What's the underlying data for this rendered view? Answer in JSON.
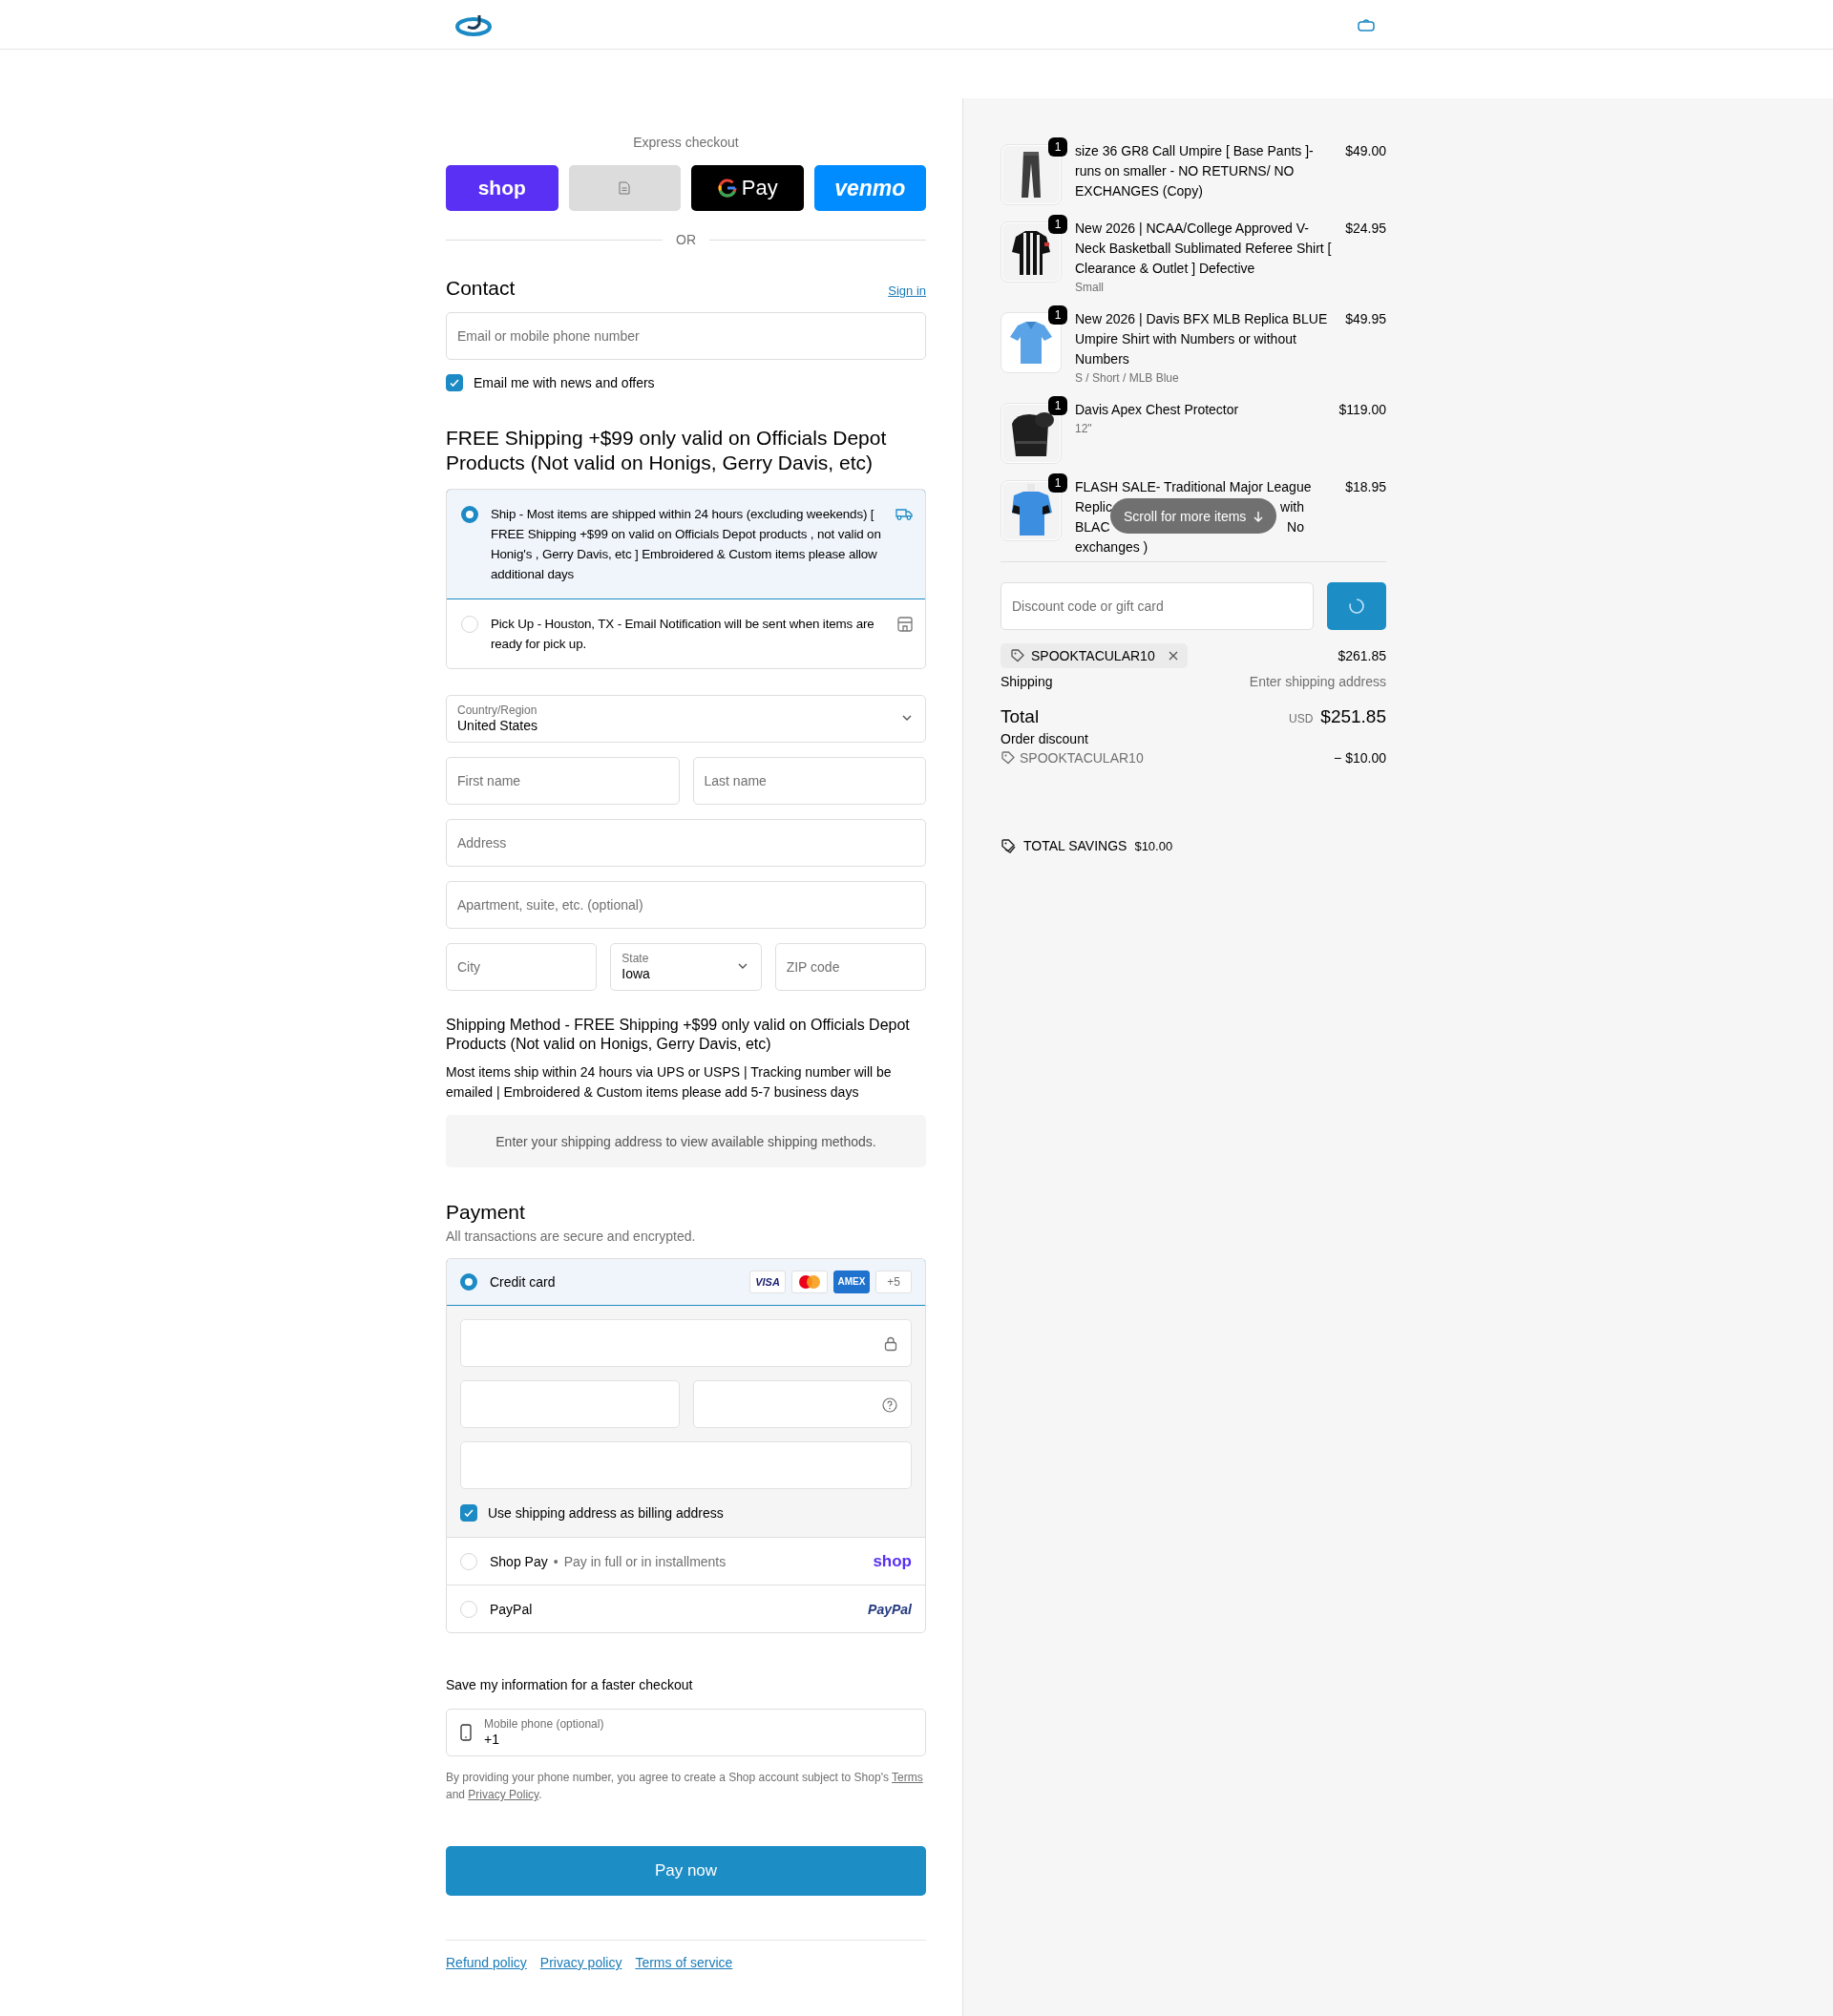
{
  "express_checkout": {
    "label": "Express checkout",
    "buttons": [
      {
        "kind": "shop",
        "label": "shop"
      },
      {
        "kind": "blank"
      },
      {
        "kind": "gpay",
        "label": "Pay"
      },
      {
        "kind": "venmo",
        "label": "venmo"
      }
    ],
    "divider": "OR"
  },
  "contact": {
    "title": "Contact",
    "sign_in": "Sign in",
    "email": {
      "placeholder": "Email or mobile phone number"
    },
    "newsletter": {
      "label": "Email me with news and offers",
      "checked": true
    }
  },
  "delivery": {
    "title": "FREE Shipping +$99 only valid on Officials Depot Products (Not valid on Honigs, Gerry Davis, etc)",
    "options": [
      {
        "kind": "ship",
        "label": "Ship - Most items are shipped within 24 hours (excluding weekends) [ FREE Shipping +$99 on valid on Officials Depot products , not valid on Honig's , Gerry Davis, etc ] Embroidered & Custom items please allow additional days",
        "selected": true
      },
      {
        "kind": "pickup",
        "label": "Pick Up - Houston, TX - Email Notification will be sent when items are ready for pick up.",
        "selected": false
      }
    ]
  },
  "address": {
    "country": {
      "label": "Country/Region",
      "value": "United States"
    },
    "first_name": {
      "placeholder": "First name"
    },
    "last_name": {
      "placeholder": "Last name"
    },
    "address": {
      "placeholder": "Address"
    },
    "apartment": {
      "placeholder": "Apartment, suite, etc. (optional)"
    },
    "city": {
      "placeholder": "City"
    },
    "state": {
      "label": "State",
      "value": "Iowa"
    },
    "zip": {
      "placeholder": "ZIP code"
    }
  },
  "shipping_method": {
    "title": "Shipping Method - FREE Shipping +$99 only valid on Officials Depot Products (Not valid on Honigs, Gerry Davis, etc)",
    "description": "Most items ship within 24 hours via UPS or USPS | Tracking number will be emailed | Embroidered & Custom items please add 5-7 business days",
    "notice": "Enter your shipping address to view available shipping methods."
  },
  "payment": {
    "title": "Payment",
    "subtitle": "All transactions are secure and encrypted.",
    "methods": [
      {
        "kind": "card",
        "label": "Credit card",
        "selected": true,
        "brands": [
          {
            "kind": "visa",
            "label": "VISA"
          },
          {
            "kind": "mastercard"
          },
          {
            "kind": "amex",
            "label": "AMEX"
          },
          {
            "kind": "more",
            "label": "+5"
          }
        ],
        "billing_same": {
          "label": "Use shipping address as billing address",
          "checked": true
        }
      },
      {
        "kind": "shoppay",
        "label": "Shop Pay",
        "separator": "•",
        "note": "Pay in full or in installments",
        "logo": "shop",
        "selected": false
      },
      {
        "kind": "paypal",
        "label": "PayPal",
        "logo": "PayPal",
        "selected": false
      }
    ]
  },
  "remember": {
    "title": "Save my information for a faster checkout",
    "phone": {
      "label": "Mobile phone (optional)",
      "value": "+1"
    },
    "legal": [
      {
        "kind": "text",
        "text": "By providing your phone number, you agree to create a Shop account subject to Shop's "
      },
      {
        "kind": "link",
        "text": "Terms"
      },
      {
        "kind": "text",
        "text": " and "
      },
      {
        "kind": "link",
        "text": "Privacy Policy"
      },
      {
        "kind": "text",
        "text": "."
      }
    ]
  },
  "pay_button": "Pay now",
  "footer_links": [
    "Refund policy",
    "Privacy policy",
    "Terms of service"
  ],
  "summary": {
    "items": [
      {
        "quantity": "1",
        "title": "size 36 GR8 Call Umpire [ Base Pants ]- runs on smaller - NO RETURNS/ NO EXCHANGES (Copy)",
        "price": "$49.00"
      },
      {
        "quantity": "1",
        "title": "New 2026 | NCAA/College Approved V-Neck Basketball Sublimated Referee Shirt [ Clearance & Outlet ] Defective",
        "variant": "Small",
        "price": "$24.95"
      },
      {
        "quantity": "1",
        "title": "New 2026 | Davis BFX MLB Replica BLUE Umpire Shirt with Numbers or without Numbers",
        "variant": "S / Short / MLB Blue",
        "price": "$49.95"
      },
      {
        "quantity": "1",
        "title": "Davis Apex Chest Protector",
        "variant": "12\"",
        "price": "$119.00"
      },
      {
        "quantity": "1",
        "title_lines": [
          [
            "FLASH SALE- Traditional Major League"
          ],
          [
            "Replic",
            "with"
          ],
          [
            "BLAC",
            "No"
          ],
          [
            "exchanges )"
          ]
        ],
        "price": "$18.95"
      }
    ],
    "scroll_hint": "Scroll for more items",
    "discount": {
      "placeholder": "Discount code or gift card"
    },
    "applied_code": "SPOOKTACULAR10",
    "subtotal": "$261.85",
    "shipping": {
      "label": "Shipping",
      "value": "Enter shipping address"
    },
    "total": {
      "label": "Total",
      "currency": "USD",
      "value": "$251.85"
    },
    "order_discount": {
      "label": "Order discount",
      "code": "SPOOKTACULAR10",
      "amount": "− $10.00"
    },
    "savings": {
      "label": "TOTAL SAVINGS",
      "amount": "$10.00"
    }
  }
}
